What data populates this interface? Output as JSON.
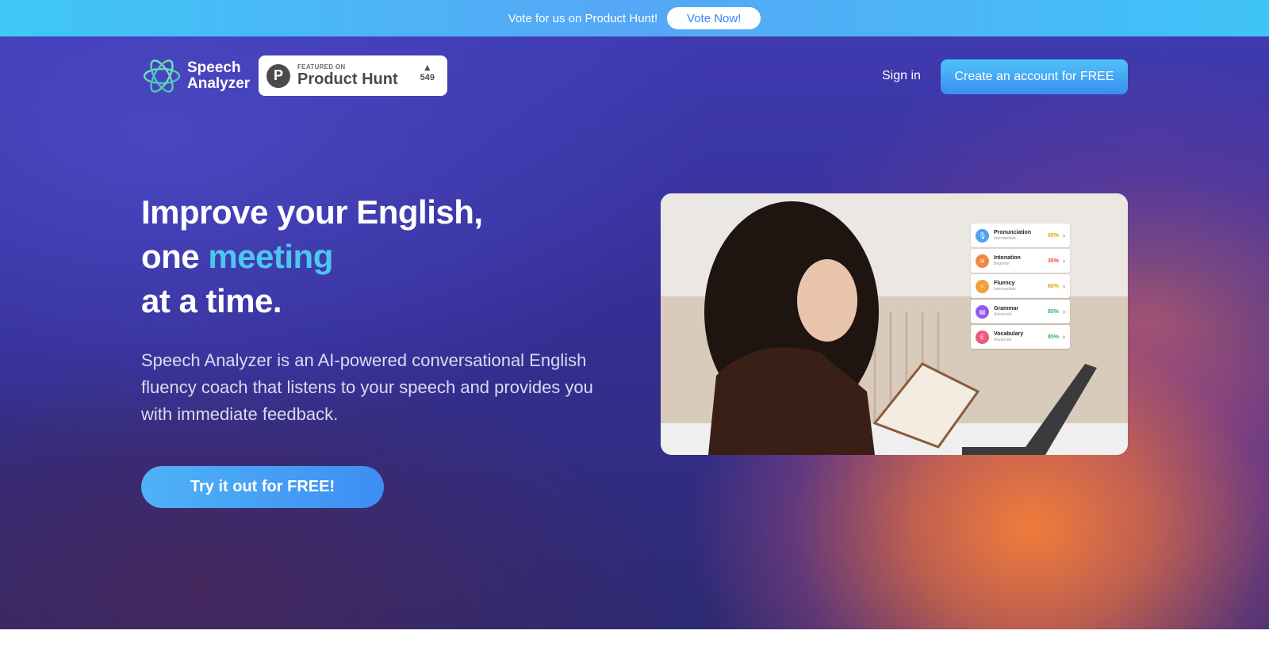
{
  "topbar": {
    "text": "Vote for us on Product Hunt!",
    "vote_label": "Vote Now!"
  },
  "nav": {
    "logo_line1": "Speech",
    "logo_line2": "Analyzer",
    "ph_featured": "FEATURED ON",
    "ph_name": "Product Hunt",
    "ph_letter": "P",
    "ph_votes": "549",
    "signin": "Sign in",
    "create_account": "Create an account for FREE"
  },
  "hero": {
    "headline_line1": "Improve your English,",
    "headline_line2_a": "one ",
    "headline_line2_accent": "meeting",
    "headline_line3": "at a time.",
    "subtext": "Speech Analyzer is an AI-powered conversational English fluency coach that listens to your speech and provides you with immediate feedback.",
    "try_button": "Try it out for FREE!"
  },
  "metrics": [
    {
      "label": "Pronunciation",
      "sub": "Intermediate",
      "pct": "65%",
      "pct_color": "#e0a500",
      "icon_color": "#4aa3f0",
      "icon": "mic-icon"
    },
    {
      "label": "Intonation",
      "sub": "Beginner",
      "pct": "35%",
      "pct_color": "#e8484a",
      "icon_color": "#f08a3c",
      "icon": "wave-icon"
    },
    {
      "label": "Fluency",
      "sub": "Intermediate",
      "pct": "60%",
      "pct_color": "#e0a500",
      "icon_color": "#f2a23c",
      "icon": "flow-icon"
    },
    {
      "label": "Grammar",
      "sub": "Advanced",
      "pct": "85%",
      "pct_color": "#2fb36b",
      "icon_color": "#8f5cf0",
      "icon": "book-icon"
    },
    {
      "label": "Vocabulary",
      "sub": "Advanced",
      "pct": "85%",
      "pct_color": "#2fb36b",
      "icon_color": "#f0587e",
      "icon": "letter-icon"
    }
  ],
  "colors": {
    "accent": "#4cc7f0",
    "button_blue": "#3b8df0",
    "topbar": "#56a7f5"
  }
}
